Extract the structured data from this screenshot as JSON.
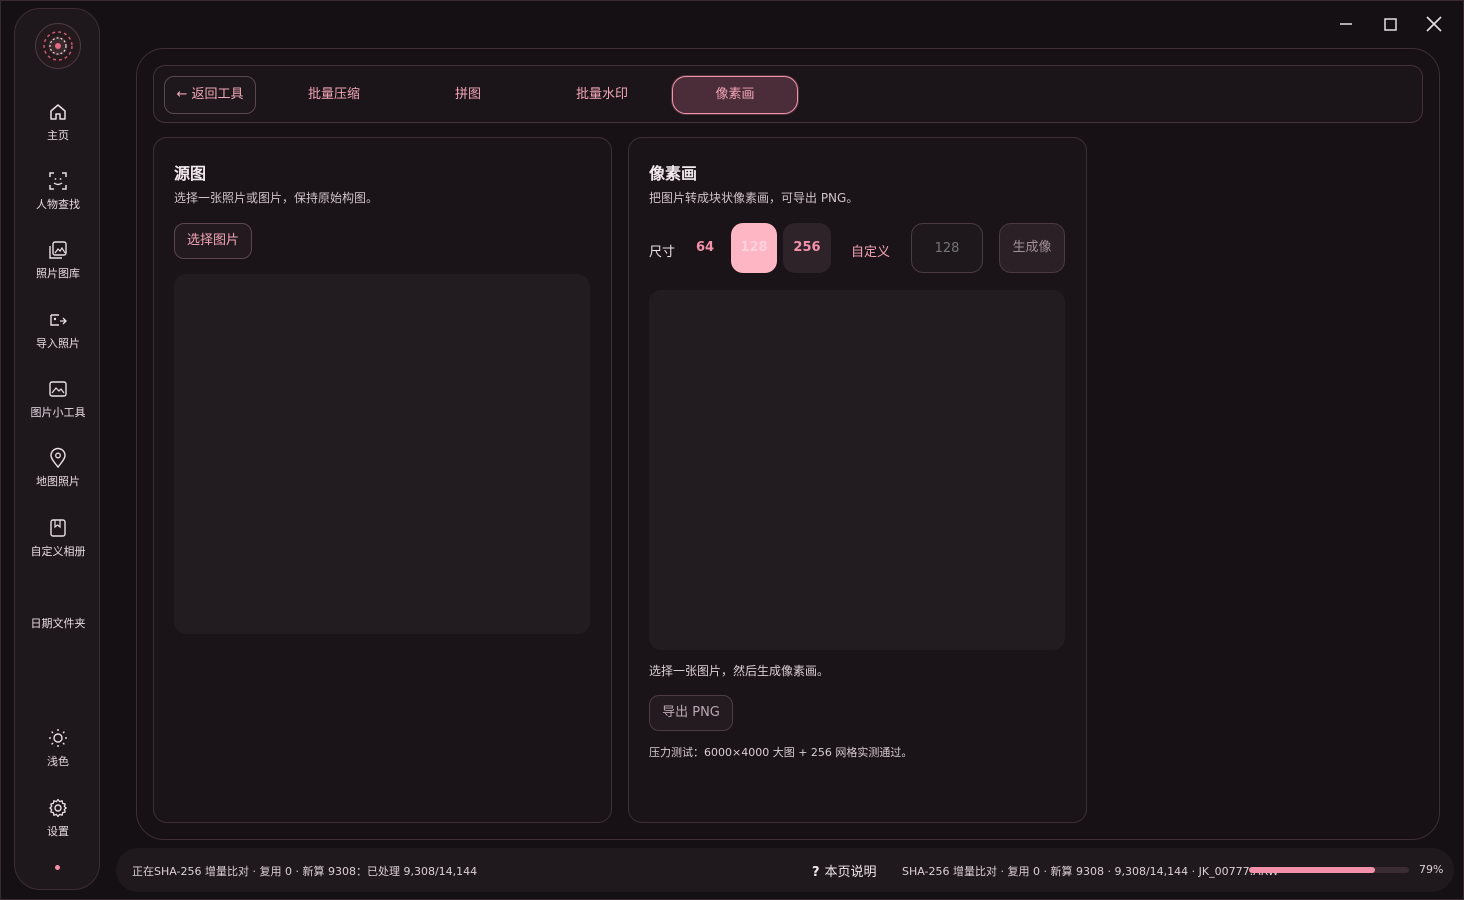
{
  "window": {
    "minimize_icon": "minimize-icon",
    "maximize_icon": "maximize-icon",
    "close_icon": "close-icon"
  },
  "sidebar": {
    "items": [
      {
        "label": "主页",
        "icon": "home-icon"
      },
      {
        "label": "人物查找",
        "icon": "face-scan-icon"
      },
      {
        "label": "照片图库",
        "icon": "gallery-icon"
      },
      {
        "label": "导入照片",
        "icon": "import-photo-icon"
      },
      {
        "label": "图片小工具",
        "icon": "image-tool-icon"
      },
      {
        "label": "地图照片",
        "icon": "map-pin-icon"
      },
      {
        "label": "自定义相册",
        "icon": "album-icon"
      },
      {
        "label": "日期文件夹",
        "icon": ""
      }
    ],
    "theme": {
      "label": "浅色",
      "icon": "sun-icon"
    },
    "settings": {
      "label": "设置",
      "icon": "gear-icon"
    }
  },
  "tabs": {
    "back": "← 返回工具",
    "items": [
      "批量压缩",
      "拼图",
      "批量水印",
      "像素画"
    ],
    "active": "像素画"
  },
  "source_panel": {
    "title": "源图",
    "subtitle": "选择一张照片或图片，保持原始构图。",
    "choose_button": "选择图片"
  },
  "pixel_panel": {
    "title": "像素画",
    "subtitle": "把图片转成块状像素画，可导出 PNG。",
    "size_label": "尺寸",
    "sizes": [
      "64",
      "128",
      "256"
    ],
    "selected_size": "128",
    "custom_label": "自定义",
    "custom_placeholder": "128",
    "generate_button": "生成像",
    "hint": "选择一张图片，然后生成像素画。",
    "export_button": "导出 PNG",
    "stress_note": "压力测试：6000×4000 大图 + 256 网格实测通过。"
  },
  "statusbar": {
    "left": "正在SHA-256 增量比对 · 复用 0 · 新算 9308：已处理 9,308/14,144",
    "help": "本页说明",
    "right": "SHA-256 增量比对 · 复用 0 · 新算 9308 · 9,308/14,144 · JK_00777.ARW",
    "progress": 0.79,
    "percent": "79%"
  },
  "colors": {
    "accent": "#f28fa9",
    "background": "#151014",
    "panel": "#1a1317",
    "active_tab": "#4a2d38"
  }
}
